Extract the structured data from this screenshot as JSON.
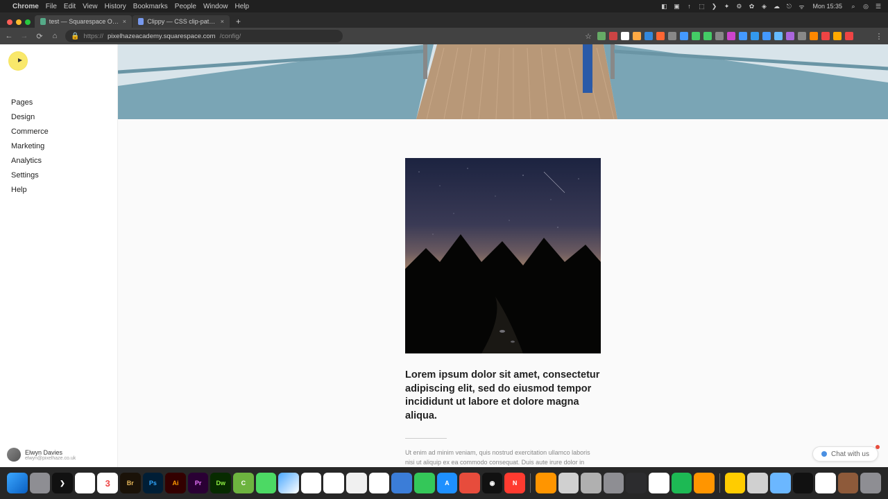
{
  "menubar": {
    "app": "Chrome",
    "items": [
      "File",
      "Edit",
      "View",
      "History",
      "Bookmarks",
      "People",
      "Window",
      "Help"
    ],
    "clock": "Mon 15:35"
  },
  "browser": {
    "tabs": [
      {
        "title": "test — Squarespace Online St…"
      },
      {
        "title": "Clippy — CSS clip-path maker"
      }
    ],
    "url_prefix": "https://",
    "url_host": "pixelhazeacademy.squarespace.com",
    "url_path": "/config/"
  },
  "sidebar": {
    "items": [
      "Pages",
      "Design",
      "Commerce",
      "Marketing",
      "Analytics",
      "Settings",
      "Help"
    ],
    "user": {
      "name": "Elwyn Davies",
      "email": "elwyn@pixelhaze.co.uk"
    }
  },
  "page": {
    "headline": "Lorem ipsum dolor sit amet, consectetur adipiscing elit, sed do eiusmod tempor incididunt ut labore et dolore magna aliqua.",
    "body": "Ut enim ad minim veniam, quis nostrud exercitation ullamco laboris nisi ut aliquip ex ea commodo consequat. Duis aute irure dolor in reprehenderit in voluptate velit esse cillum dolore eu fugiat nulla pariatur. Excepteur sint occaecat cupidatat non proident, sunt in culpa qui officia deserunt mollit anim"
  },
  "chat": {
    "label": "Chat with us"
  },
  "dock": {
    "apps": [
      {
        "n": "finder",
        "bg": "linear-gradient(135deg,#3ba7ff,#0a5fc2)",
        "t": ""
      },
      {
        "n": "launchpad",
        "bg": "#8e8e93",
        "t": ""
      },
      {
        "n": "iterm",
        "bg": "#111",
        "t": "❯"
      },
      {
        "n": "chrome",
        "bg": "#fff",
        "t": "◉"
      },
      {
        "n": "calendar",
        "bg": "#fff",
        "t": "3"
      },
      {
        "n": "bridge",
        "bg": "#1a1208",
        "t": "Br"
      },
      {
        "n": "photoshop",
        "bg": "#001e36",
        "t": "Ps"
      },
      {
        "n": "illustrator",
        "bg": "#330000",
        "t": "Ai"
      },
      {
        "n": "premiere",
        "bg": "#2a0034",
        "t": "Pr"
      },
      {
        "n": "dreamweaver",
        "bg": "#072b00",
        "t": "Dw"
      },
      {
        "n": "camtasia",
        "bg": "#6db33f",
        "t": "C"
      },
      {
        "n": "app1",
        "bg": "#4cd964",
        "t": ""
      },
      {
        "n": "safari",
        "bg": "linear-gradient(135deg,#4aa8ff,#fff)",
        "t": ""
      },
      {
        "n": "textedit",
        "bg": "#fff",
        "t": ""
      },
      {
        "n": "app2",
        "bg": "#fff",
        "t": ""
      },
      {
        "n": "app3",
        "bg": "#f0f0f0",
        "t": ""
      },
      {
        "n": "photos",
        "bg": "#fff",
        "t": "❀"
      },
      {
        "n": "preview",
        "bg": "#3b7dd8",
        "t": ""
      },
      {
        "n": "messages",
        "bg": "#34c759",
        "t": ""
      },
      {
        "n": "appstore",
        "bg": "#1e90ff",
        "t": "A"
      },
      {
        "n": "app4",
        "bg": "#e74c3c",
        "t": ""
      },
      {
        "n": "siri",
        "bg": "#111",
        "t": "◉"
      },
      {
        "n": "news",
        "bg": "#ff3b30",
        "t": "N"
      },
      {
        "n": "pages",
        "bg": "#ff9500",
        "t": ""
      },
      {
        "n": "printer",
        "bg": "#d0d0d0",
        "t": ""
      },
      {
        "n": "app6",
        "bg": "#b0b0b0",
        "t": ""
      },
      {
        "n": "app7",
        "bg": "#8e8e93",
        "t": ""
      },
      {
        "n": "app8",
        "bg": "#2c2c2e",
        "t": ""
      },
      {
        "n": "numbers",
        "bg": "#fff",
        "t": "▮"
      },
      {
        "n": "spotify",
        "bg": "#1db954",
        "t": ""
      },
      {
        "n": "app9",
        "bg": "#ff9500",
        "t": ""
      },
      {
        "n": "app10",
        "bg": "#ffcc00",
        "t": ""
      },
      {
        "n": "app11",
        "bg": "#d0d0d0",
        "t": ""
      },
      {
        "n": "folder",
        "bg": "#6bb7ff",
        "t": ""
      },
      {
        "n": "app12",
        "bg": "#111",
        "t": ""
      },
      {
        "n": "app13",
        "bg": "#fff",
        "t": ""
      },
      {
        "n": "app14",
        "bg": "#8e5a3a",
        "t": ""
      },
      {
        "n": "trash",
        "bg": "#8e8e93",
        "t": ""
      }
    ]
  }
}
